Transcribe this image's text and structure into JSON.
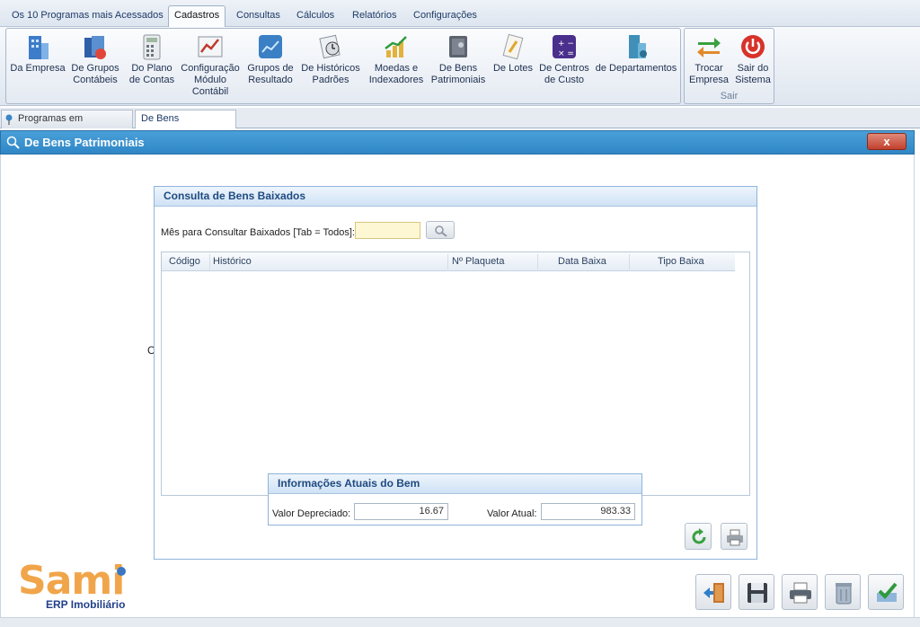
{
  "menu": {
    "tabs": [
      "Os 10 Programas mais Acessados",
      "Cadastros",
      "Consultas",
      "Cálculos",
      "Relatórios",
      "Configurações"
    ],
    "active": "Cadastros"
  },
  "ribbon": {
    "buttons": [
      {
        "label": "Da Empresa",
        "icon": "building-icon"
      },
      {
        "label": "De Grupos\nContábeis",
        "icon": "book-group-icon"
      },
      {
        "label": "Do Plano\nde Contas",
        "icon": "calculator-icon"
      },
      {
        "label": "Configuração\nMódulo\nContábil",
        "icon": "chart-config-icon"
      },
      {
        "label": "Grupos de\nResultado",
        "icon": "result-chart-icon"
      },
      {
        "label": "De Históricos\nPadrões",
        "icon": "history-icon"
      },
      {
        "label": "Moedas e\nIndexadores",
        "icon": "money-chart-icon"
      },
      {
        "label": "De Bens\nPatrimoniais",
        "icon": "safe-icon"
      },
      {
        "label": "De Lotes",
        "icon": "lot-icon"
      },
      {
        "label": "De Centros\nde Custo",
        "icon": "calculator-cost-icon"
      },
      {
        "label": "de Departamentos",
        "icon": "department-icon"
      }
    ],
    "exit_group": {
      "caption": "Sair",
      "buttons": [
        {
          "label": "Trocar\nEmpresa",
          "icon": "switch-arrows-icon"
        },
        {
          "label": "Sair do\nSistema",
          "icon": "power-icon"
        }
      ]
    }
  },
  "doc_tabs": [
    "Programas em Execução",
    "De Bens Patrimoniais"
  ],
  "window": {
    "title": "De Bens Patrimoniais",
    "close": "x"
  },
  "stray_text": "C",
  "panel": {
    "title": "Consulta de Bens Baixados",
    "mes_label": "Mês para Consultar Baixados [Tab = Todos]:",
    "mes_value": "",
    "columns": [
      "Código",
      "Histórico",
      "Nº Plaqueta",
      "Data Baixa",
      "Tipo Baixa"
    ]
  },
  "info": {
    "title": "Informações Atuais do Bem",
    "valor_depreciado_label": "Valor Depreciado:",
    "valor_depreciado": "16.67",
    "valor_atual_label": "Valor Atual:",
    "valor_atual": "983.33"
  },
  "logo": {
    "brand": "Sami",
    "sub": "ERP Imobiliário"
  },
  "colors": {
    "title_bar": "#3592cf",
    "panel_border": "#8fb4da",
    "panel_header_text": "#1f4a80",
    "logo_orange": "#f1a54a",
    "logo_blue": "#22408a"
  }
}
